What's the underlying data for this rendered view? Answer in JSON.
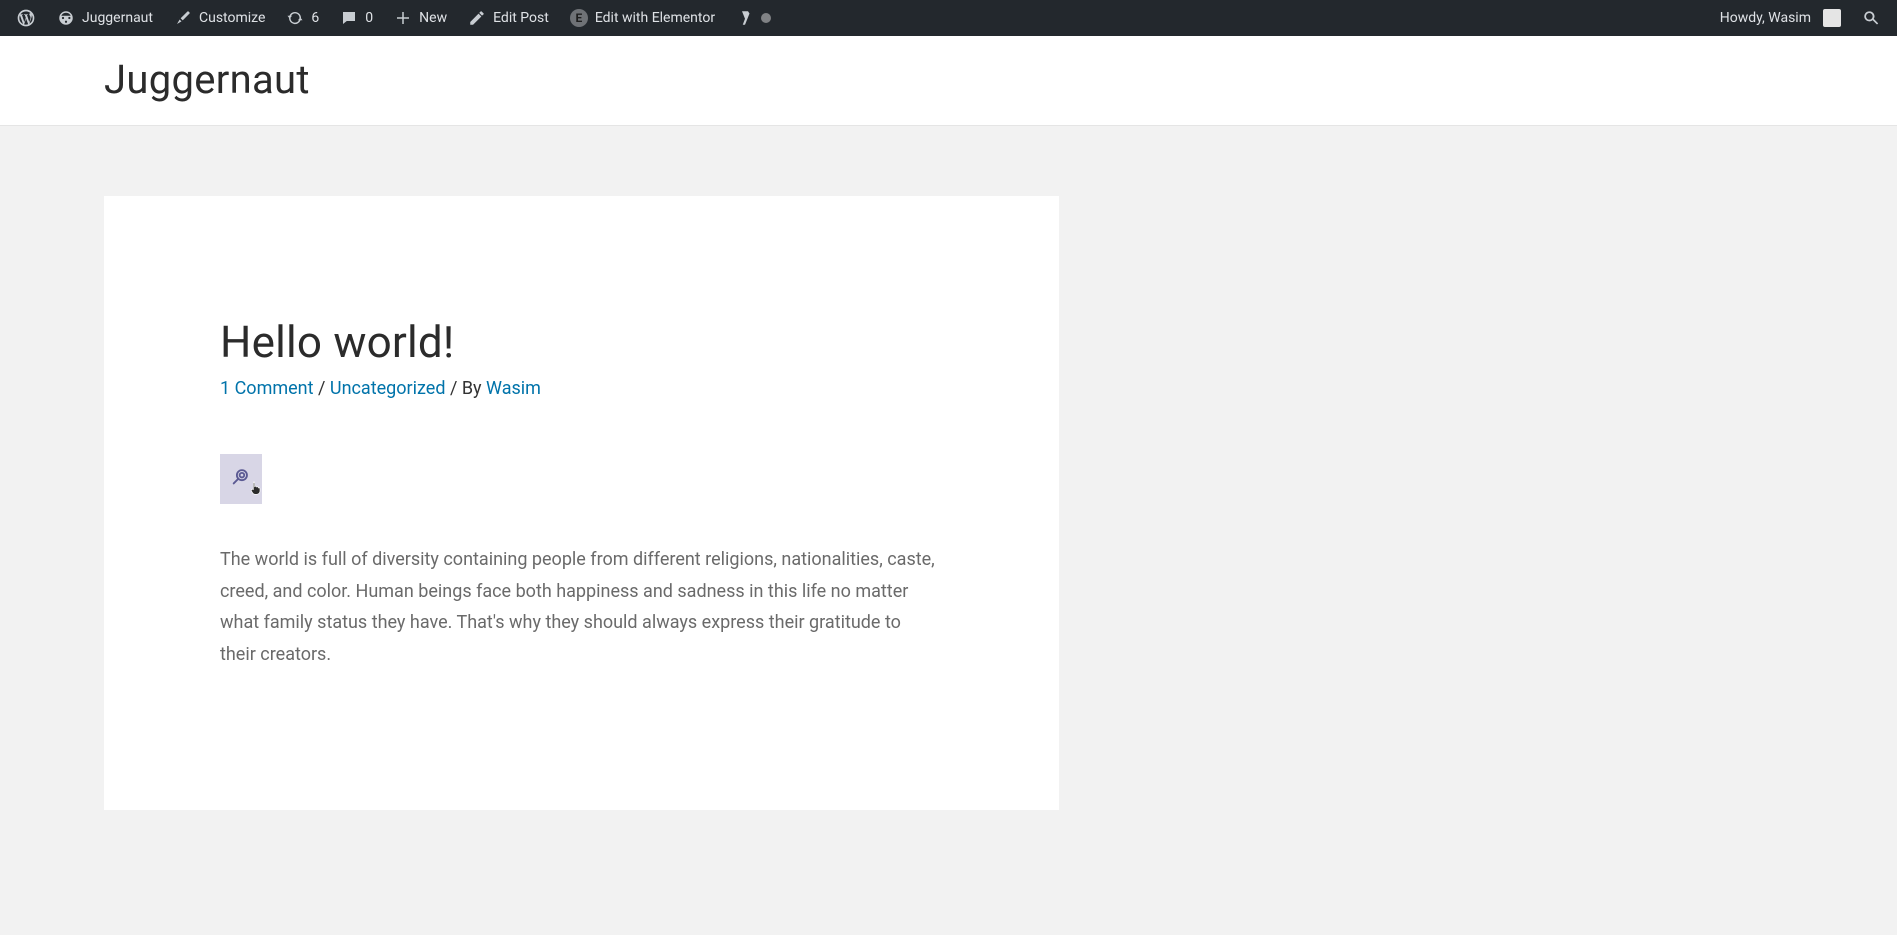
{
  "admin_bar": {
    "site_name": "Juggernaut",
    "customize": "Customize",
    "updates_count": "6",
    "comments_count": "0",
    "new_label": "New",
    "edit_post": "Edit Post",
    "edit_elementor": "Edit with Elementor",
    "howdy": "Howdy, Wasim"
  },
  "site": {
    "title": "Juggernaut"
  },
  "post": {
    "title": "Hello world!",
    "comments_text": "1 Comment",
    "sep1": " / ",
    "category": "Uncategorized",
    "by_text": " / By ",
    "author": "Wasim",
    "body": "The world is full of diversity containing people from different religions, nationalities, caste, creed, and color. Human beings face both happiness and sadness in this life no matter what family status they have. That's why they should always express their gratitude to their creators."
  }
}
